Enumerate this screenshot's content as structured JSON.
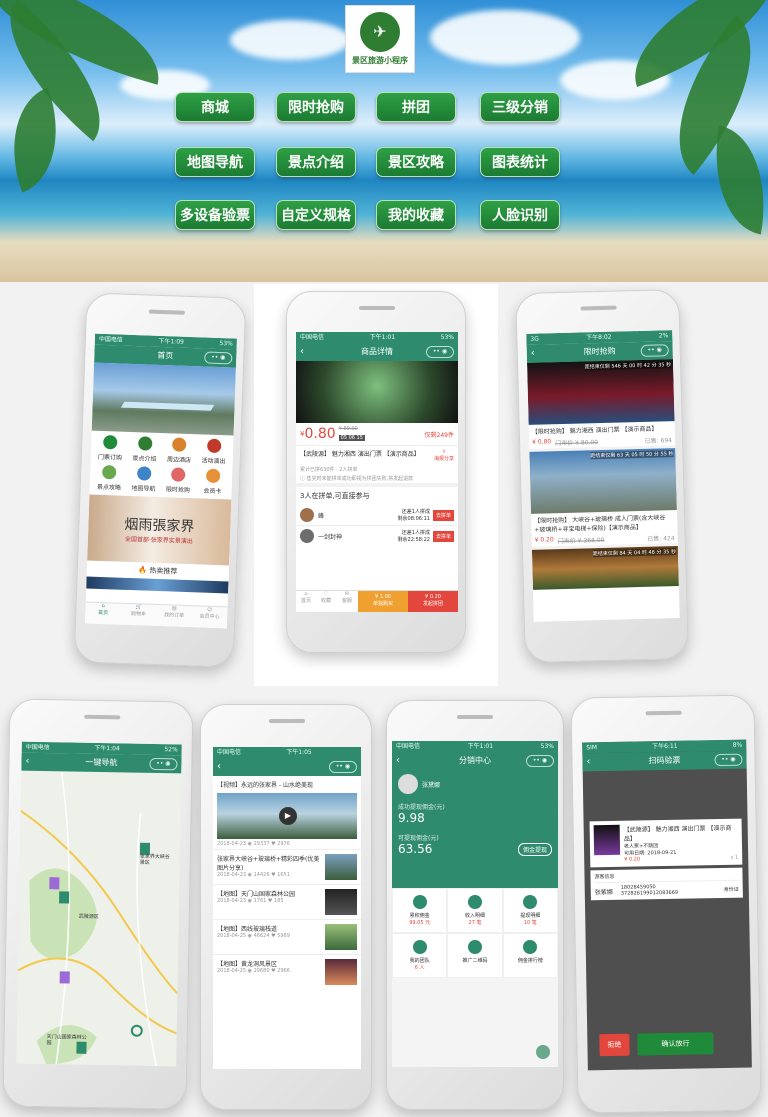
{
  "banner": {
    "logo_text": "景区旅游小程序",
    "features": [
      "商城",
      "限时抢购",
      "拼团",
      "三级分销",
      "地图导航",
      "景点介绍",
      "景区攻略",
      "图表统计",
      "多设备验票",
      "自定义规格",
      "我的收藏",
      "人脸识别"
    ]
  },
  "colors": {
    "theme": "#2e8b6e",
    "button": "#1f8b3a",
    "price": "#e2463c"
  },
  "home": {
    "status_left": "中国电信",
    "status_time": "下午1:09",
    "status_right": "53%",
    "title": "首页",
    "icons": [
      "门票订购",
      "景点介绍",
      "周边酒店",
      "活动演出",
      "景点攻略",
      "地图导航",
      "限时抢购",
      "会员卡"
    ],
    "banner_text": "烟雨張家界",
    "banner_sub": "全国首部·张家界实景演出",
    "hot_title": "热卖推荐",
    "tabs": [
      "首页",
      "购物车",
      "我的订单",
      "会员中心"
    ]
  },
  "detail": {
    "status_left": "中国电信",
    "status_time": "下午1:01",
    "status_right": "53%",
    "title": "商品详情",
    "price": "0.80",
    "old_price": "¥ 80.00",
    "countdown": "05 06 15",
    "group_info": "仅剩249件",
    "name": "【武陵源】 魅力湘西 演出门票 【演示商品】",
    "share": "海报分享",
    "stat": "累计已拼630件 · 2人拼单",
    "notice": "售完时未能拼单成功即视为拼团失败,将发起退款",
    "group_title": "3人在拼单,可直接参与",
    "groups": [
      {
        "user": "峰",
        "need": "还差1人拼成",
        "left": "剩余08:06:11",
        "btn": "去拼单"
      },
      {
        "user": "一剑封神",
        "need": "还差1人拼成",
        "left": "剩余22:58:22",
        "btn": "去拼单"
      }
    ],
    "tabs": [
      "首页",
      "收藏",
      "客服"
    ],
    "solo": "¥ 1.00",
    "solo_lbl": "单独购买",
    "team": "¥ 0.20",
    "team_lbl": "发起拼团"
  },
  "flash": {
    "status_left": "3G",
    "status_time": "下午8:02",
    "status_right": "2%",
    "title": "限时抢购",
    "timer_lbl": "距结束仅剩",
    "items": [
      {
        "timer": "546 天 00 时 42 分 35 秒",
        "name": "【限时抢购】 魅力湘西 演出门票 【演示商品】",
        "price": "¥ 0.80",
        "old": "门市价 ¥ 80.00",
        "sold": "已售: 694"
      },
      {
        "timer": "63 天 05 时 50 分 55 秒",
        "name": "【限时抢购】 大峡谷+玻璃桥 成人门票(含大峡谷+玻璃桥+寻宝电梯+保险)【演示商品】",
        "price": "¥ 0.20",
        "old": "门市价 ¥ 368.00",
        "sold": "已售: 424"
      },
      {
        "timer": "84 天 04 时 46 分 35 秒"
      }
    ]
  },
  "map": {
    "status_left": "中国电信",
    "status_time": "下午1:04",
    "status_right": "52%",
    "title": "一键导航",
    "labels": [
      "张家界大峡谷景区",
      "武陵源区",
      "天门山国家森林公园"
    ]
  },
  "news": {
    "status_left": "中国电信",
    "status_time": "下午1:05",
    "status_right": "",
    "title": "",
    "feature": {
      "title": "【视频】永远的张家界 - 山水绝美现",
      "date": "2018-04-23",
      "views": "29337",
      "likes": "2976"
    },
    "items": [
      {
        "title": "张家界大峡谷+玻璃桥+精彩四季(优美图片分享)",
        "date": "2018-04-23",
        "views": "14426",
        "likes": "1651"
      },
      {
        "title": "【地图】天门山国家森林公园",
        "date": "2018-04-23",
        "views": "1761",
        "likes": "185"
      },
      {
        "title": "【地图】西线玻璃栈道",
        "date": "2018-04-25",
        "views": "46624",
        "likes": "5969"
      },
      {
        "title": "【地图】黄龙洞风景区",
        "date": "2018-04-25",
        "views": "29680",
        "likes": "2966"
      }
    ]
  },
  "dist": {
    "status_left": "中国电信",
    "status_time": "下午1:01",
    "status_right": "53%",
    "title": "分销中心",
    "user": "张黛娜",
    "amount_lbl": "成功提现佣金(元)",
    "amount": "9.98",
    "avail_lbl": "可提现佣金(元)",
    "avail": "63.56",
    "withdraw": "佣金提现",
    "grid": [
      {
        "lbl": "累积佣金",
        "val": "99.05 元"
      },
      {
        "lbl": "收入明细",
        "val": "27 笔"
      },
      {
        "lbl": "提现明细",
        "val": "10 笔"
      },
      {
        "lbl": "我的团队",
        "val": "6 人"
      },
      {
        "lbl": "推广二维码",
        "val": ""
      },
      {
        "lbl": "佣金排行榜",
        "val": ""
      }
    ]
  },
  "scan": {
    "status_left": "SIM",
    "status_time": "下午6:11",
    "status_right": "8%",
    "title": "扫码验票",
    "ticket": "【武陵源】 魅力湘西 演出门票 【演示商品】",
    "spec": "老人票+不跳团",
    "date": "可用日期: 2018-09-21",
    "price": "¥ 0.20",
    "qty": "x 1",
    "info_title": "游客信息",
    "name": "张紫娜",
    "phone": "18028459050",
    "id": "372826199012083669",
    "id_lbl": "身份证",
    "reject": "拒绝",
    "confirm": "确认放行"
  }
}
